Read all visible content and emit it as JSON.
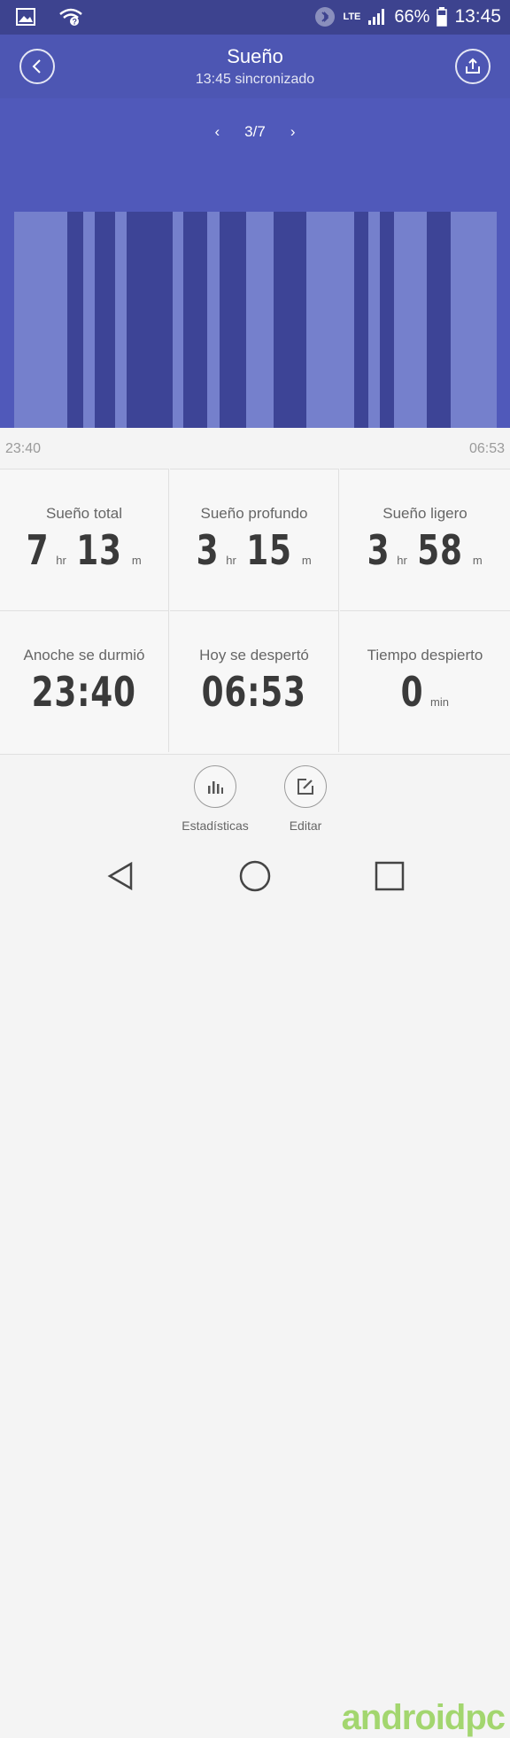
{
  "status_bar": {
    "network": "LTE",
    "battery": "66%",
    "time": "13:45"
  },
  "header": {
    "title": "Sueño",
    "subtitle": "13:45 sincronizado"
  },
  "pager": {
    "label": "3/7"
  },
  "timeline": {
    "start": "23:40",
    "end": "06:53",
    "legend_colors": {
      "light": "#7580cc",
      "deep": "#3d4496",
      "background": "#5059ba"
    }
  },
  "stats": [
    {
      "label": "Sueño total",
      "v1": "7",
      "u1": "hr",
      "v2": "13",
      "u2": "m"
    },
    {
      "label": "Sueño profundo",
      "v1": "3",
      "u1": "hr",
      "v2": "15",
      "u2": "m"
    },
    {
      "label": "Sueño ligero",
      "v1": "3",
      "u1": "hr",
      "v2": "58",
      "u2": "m"
    },
    {
      "label": "Anoche se durmió",
      "value": "23:40"
    },
    {
      "label": "Hoy se despertó",
      "value": "06:53"
    },
    {
      "label": "Tiempo despierto",
      "value": "0",
      "unit": "min"
    }
  ],
  "actions": {
    "stats_label": "Estadísticas",
    "edit_label": "Editar"
  },
  "watermark": "androidpc"
}
